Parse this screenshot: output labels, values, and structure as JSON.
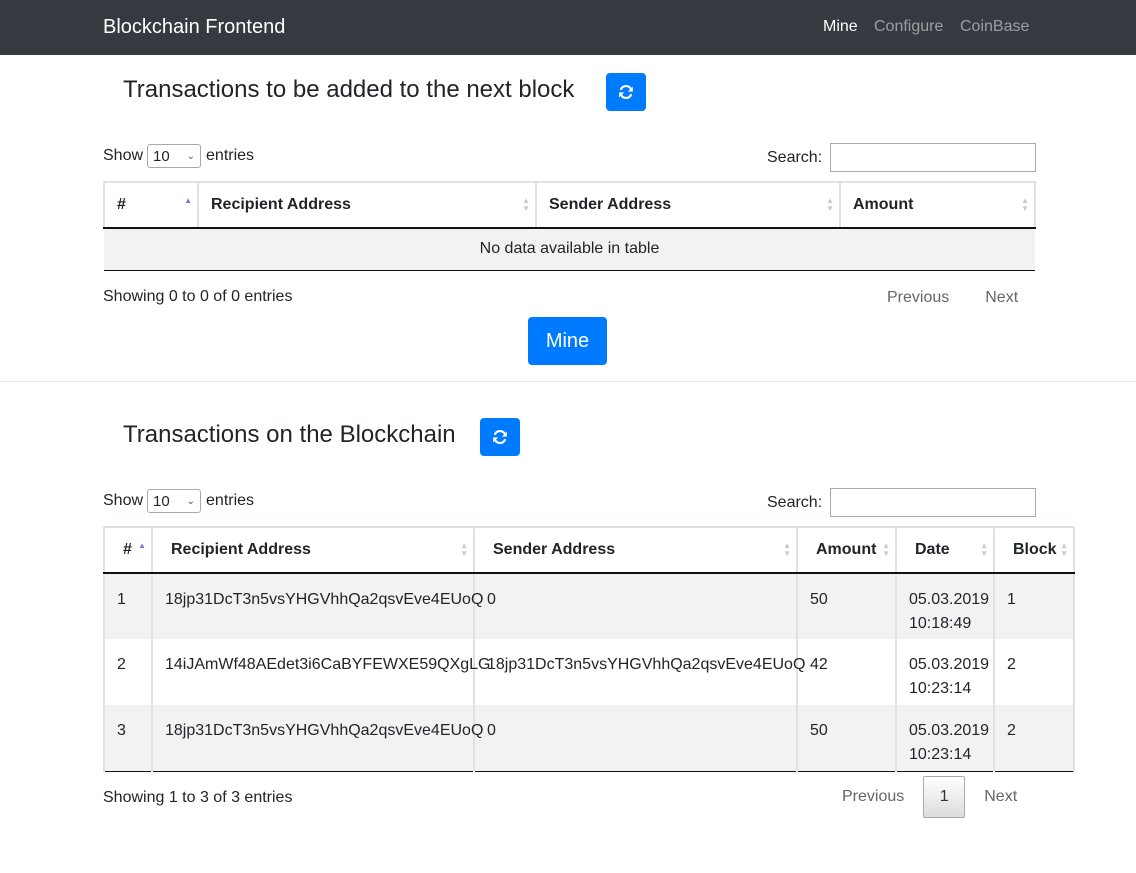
{
  "navbar": {
    "brand": "Blockchain Frontend",
    "links": [
      "Mine",
      "Configure",
      "CoinBase"
    ]
  },
  "pending": {
    "title": "Transactions to be added to the next block",
    "refresh_icon": "refresh-icon",
    "length": {
      "show": "Show",
      "value": "10",
      "entries": "entries"
    },
    "search_label": "Search:",
    "search_value": "",
    "headers": [
      "#",
      "Recipient Address",
      "Sender Address",
      "Amount"
    ],
    "empty_text": "No data available in table",
    "info": "Showing 0 to 0 of 0 entries",
    "pager": {
      "prev": "Previous",
      "next": "Next"
    },
    "mine_label": "Mine"
  },
  "chain": {
    "title": "Transactions on the Blockchain",
    "refresh_icon": "refresh-icon",
    "length": {
      "show": "Show",
      "value": "10",
      "entries": "entries"
    },
    "search_label": "Search:",
    "search_value": "",
    "headers": [
      "#",
      "Recipient Address",
      "Sender Address",
      "Amount",
      "Date",
      "Block"
    ],
    "rows": [
      {
        "num": "1",
        "recipient": "18jp31DcT3n5vsYHGVhhQa2qsvEve4EUoQ",
        "sender": "0",
        "amount": "50",
        "date": "05.03.2019",
        "time": "10:18:49",
        "block": "1"
      },
      {
        "num": "2",
        "recipient": "14iJAmWf48AEdet3i6CaBYFEWXE59QXgLG",
        "sender": "18jp31DcT3n5vsYHGVhhQa2qsvEve4EUoQ",
        "amount": "42",
        "date": "05.03.2019",
        "time": "10:23:14",
        "block": "2"
      },
      {
        "num": "3",
        "recipient": "18jp31DcT3n5vsYHGVhhQa2qsvEve4EUoQ",
        "sender": "0",
        "amount": "50",
        "date": "05.03.2019",
        "time": "10:23:14",
        "block": "2"
      }
    ],
    "info": "Showing 1 to 3 of 3 entries",
    "pager": {
      "prev": "Previous",
      "current": "1",
      "next": "Next"
    }
  },
  "colors": {
    "navbar": "#343a40",
    "primary": "#007bff"
  }
}
